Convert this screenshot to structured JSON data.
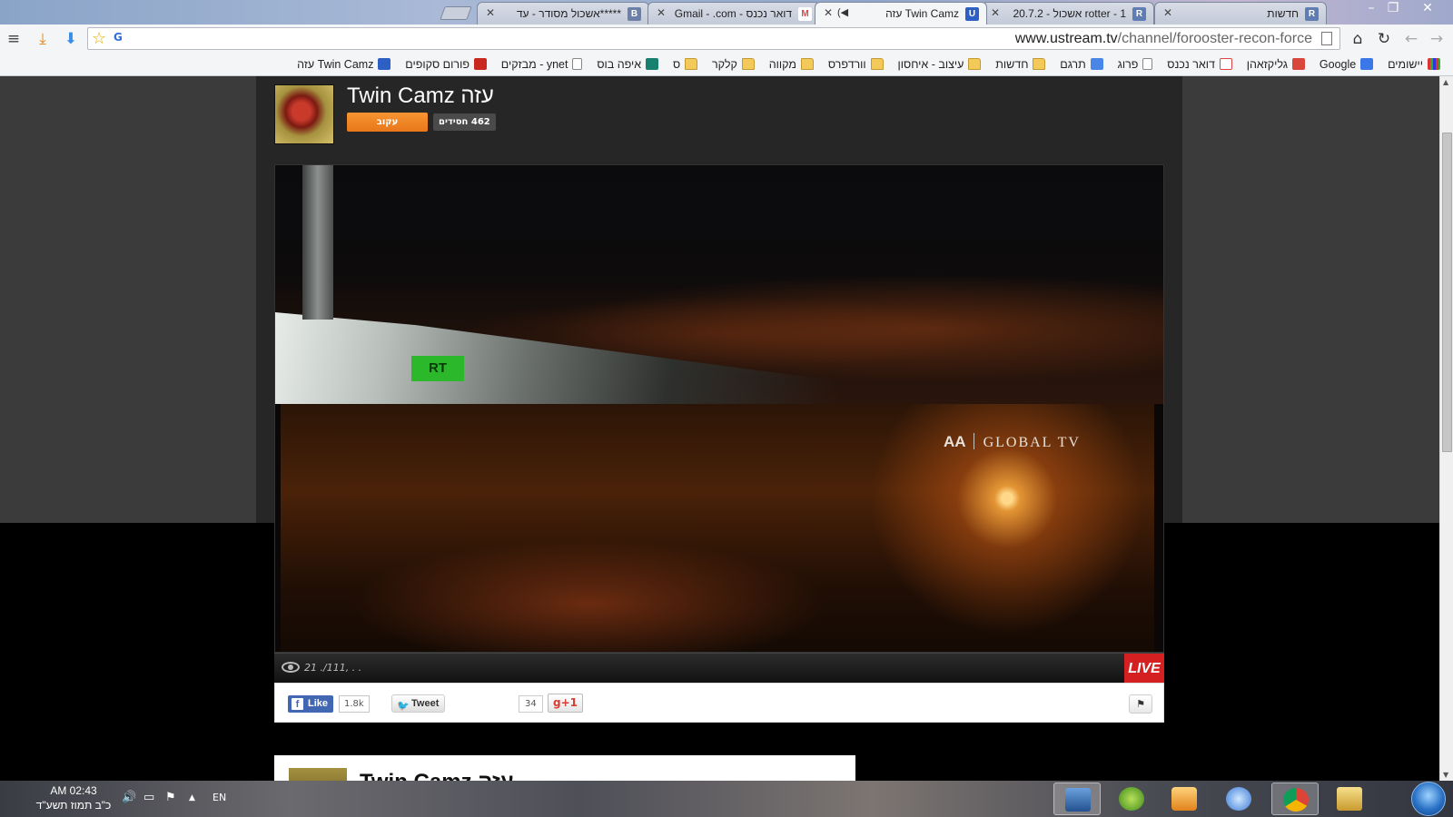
{
  "browser": {
    "tabs": [
      {
        "title": "חדשות",
        "favicon": "R"
      },
      {
        "title": "rotter - 1 אשכול - 20.7.2",
        "favicon": "R"
      },
      {
        "title": "Twin Camz עזה",
        "favicon": "U",
        "active": true
      },
      {
        "title": "דואר נכנס - Gmail - .com",
        "favicon": "M"
      },
      {
        "title": "*****אשכול מסודר - עד",
        "favicon": "B"
      }
    ],
    "address": {
      "host": "www.ustream.tv",
      "path": "/channel/forooster-recon-force"
    },
    "bookmarks": [
      {
        "label": "יישומים",
        "icon": "apps-icon"
      },
      {
        "label": "Google",
        "icon": "google-icon"
      },
      {
        "label": "גליקזאהן",
        "icon": "gplus-icon"
      },
      {
        "label": "דואר נכנס",
        "icon": "gmail-icon"
      },
      {
        "label": "פרוג",
        "icon": "page-icon"
      },
      {
        "label": "תרגם",
        "icon": "translate-icon"
      },
      {
        "label": "חדשות",
        "icon": "folder-icon"
      },
      {
        "label": "עיצוב - איחסון",
        "icon": "folder-icon"
      },
      {
        "label": "וורדפרס",
        "icon": "folder-icon"
      },
      {
        "label": "מקווה",
        "icon": "folder-icon"
      },
      {
        "label": "קלקר",
        "icon": "folder-icon"
      },
      {
        "label": "ס",
        "icon": "folder-icon"
      },
      {
        "label": "איפה בוס",
        "icon": "app-icon"
      },
      {
        "label": "ynet - מבזקים",
        "icon": "page-icon"
      },
      {
        "label": "פורום סקופים",
        "icon": "rotter-icon"
      },
      {
        "label": "Twin Camz עזה",
        "icon": "ustream-icon"
      }
    ]
  },
  "channel": {
    "title": "Twin Camz עזה",
    "follow_label": "עקוב",
    "followers_label": "462 חסידים"
  },
  "video": {
    "top_logo": "RT",
    "bottom_logo_mark": "AA",
    "bottom_logo_text": "GLOBAL TV"
  },
  "player": {
    "viewers_text": "21 ./111, . .",
    "live_label": "LIVE"
  },
  "social": {
    "like_label": "Like",
    "like_count": "1.8k",
    "tweet_label": "Tweet",
    "gplus_count": "34",
    "gplus_label": "g+1"
  },
  "lower_card": {
    "title": "Twin Camz עזה"
  },
  "taskbar": {
    "time": "AM 02:43",
    "date": "כ\"ב תמוז תשע\"ד",
    "lang": "EN"
  }
}
